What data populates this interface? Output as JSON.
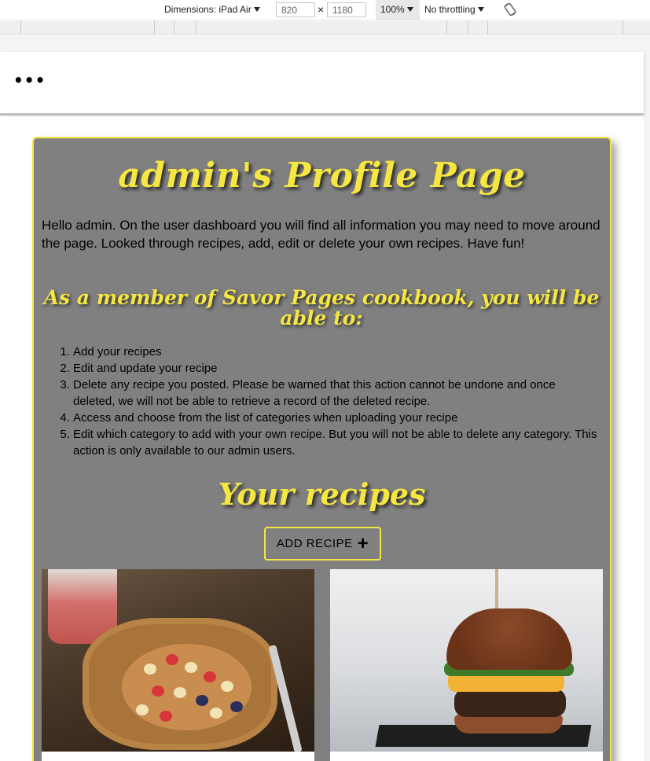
{
  "devtools": {
    "dimensions_label": "Dimensions: iPad Air",
    "width_value": "820",
    "times_symbol": "×",
    "height_value": "1180",
    "zoom": "100%",
    "throttling": "No throttling",
    "rotate_icon": "rotate-icon"
  },
  "header": {
    "more_label": "•••"
  },
  "profile": {
    "title": "admin's Profile Page",
    "intro": "Hello admin. On the user dashboard you will find all information you may need to move around the page. Looked through recipes, add, edit or delete your own recipes. Have fun!",
    "subtitle": "As a member of Savor Pages cookbook, you will be able to:",
    "permissions": [
      "Add your recipes",
      "Edit and update your recipe",
      "Delete any recipe you posted. Please be warned that this action cannot be undone and once deleted, we will not be able to retrieve a record of the deleted recipe.",
      "Access and choose from the list of categories when uploading your recipe",
      "Edit which category to add with your own recipe. But you will not be able to delete any category. This action is only available to our admin users."
    ],
    "recipes_title": "Your recipes",
    "add_button_label": "ADD RECIPE",
    "add_button_icon": "+"
  },
  "colors": {
    "accent_yellow": "#f5e642",
    "card_grey": "#808080"
  }
}
